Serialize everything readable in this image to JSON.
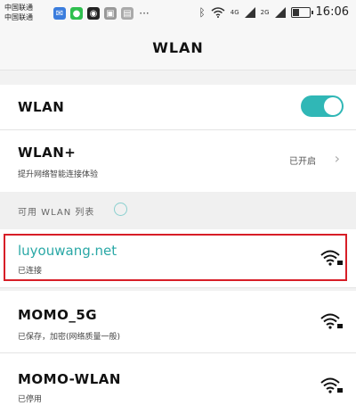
{
  "status_bar": {
    "carrier_1": "中国联通",
    "carrier_2": "中国联通",
    "time": "16:06",
    "net_4g": "4G",
    "net_2g": "2G",
    "more": "···"
  },
  "header": {
    "title": "WLAN"
  },
  "wlan_toggle": {
    "label": "WLAN",
    "enabled": true
  },
  "wlan_plus": {
    "label": "WLAN+",
    "description": "提升网络智能连接体验",
    "status": "已开启"
  },
  "available_section": {
    "label": "可用 WLAN 列表"
  },
  "networks": [
    {
      "ssid": "luyouwang.net",
      "status": "已连接"
    },
    {
      "ssid": "MOMO_5G",
      "status": "已保存，加密(网络质量一般)"
    },
    {
      "ssid": "MOMO-WLAN",
      "status": "已停用"
    }
  ],
  "colors": {
    "accent": "#30b7b6",
    "highlight": "#d71e27",
    "connected_text": "#2aa8a6"
  }
}
